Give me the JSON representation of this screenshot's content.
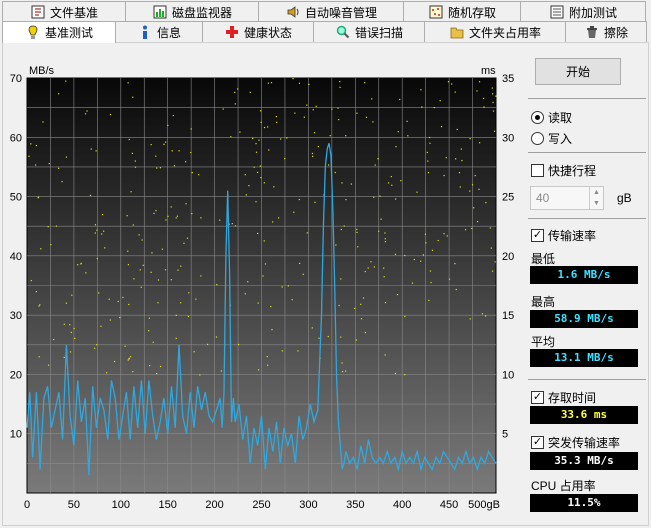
{
  "tabs_top": [
    {
      "label": "文件基准",
      "icon": "file-benchmark-icon"
    },
    {
      "label": "磁盘监视器",
      "icon": "disk-monitor-icon"
    },
    {
      "label": "自动噪音管理",
      "icon": "speaker-icon"
    },
    {
      "label": "随机存取",
      "icon": "random-access-icon"
    },
    {
      "label": "附加测试",
      "icon": "extra-tests-icon"
    }
  ],
  "tabs_bottom": [
    {
      "label": "基准测试",
      "icon": "benchmark-icon",
      "active": true
    },
    {
      "label": "信息",
      "icon": "info-icon"
    },
    {
      "label": "健康状态",
      "icon": "health-cross-icon"
    },
    {
      "label": "错误扫描",
      "icon": "error-scan-icon"
    },
    {
      "label": "文件夹占用率",
      "icon": "folder-usage-icon"
    },
    {
      "label": "擦除",
      "icon": "erase-icon"
    }
  ],
  "panel": {
    "start_label": "开始",
    "read_label": "读取",
    "write_label": "写入",
    "short_stroke_label": "快捷行程",
    "short_stroke_value": "40",
    "short_stroke_unit": "gB",
    "transfer_rate_label": "传输速率",
    "min_label": "最低",
    "min_value": "1.6 MB/s",
    "max_label": "最高",
    "max_value": "58.9 MB/s",
    "avg_label": "平均",
    "avg_value": "13.1 MB/s",
    "access_time_label": "存取时间",
    "access_time_value": "33.6 ms",
    "burst_rate_label": "突发传输速率",
    "burst_rate_value": "35.3 MB/s",
    "cpu_label": "CPU 占用率",
    "cpu_value": "11.5%"
  },
  "chart_data": {
    "type": "line",
    "y_left_label": "MB/s",
    "y_right_label": "ms",
    "x_max_label": "500gB",
    "ylim_left": [
      0,
      70
    ],
    "ylim_right": [
      0,
      35
    ],
    "xlim": [
      0,
      500
    ],
    "x_ticks": [
      "0",
      "50",
      "100",
      "150",
      "200",
      "250",
      "300",
      "350",
      "400",
      "450",
      "500gB"
    ],
    "y_left_ticks": [
      "70",
      "60",
      "50",
      "40",
      "30",
      "20",
      "10"
    ],
    "y_right_ticks": [
      "35",
      "30",
      "25",
      "20",
      "15",
      "10",
      "5"
    ],
    "grid": true,
    "series": [
      {
        "name": "传输速率",
        "color": "#2fa8e0",
        "x": [
          0,
          3,
          6,
          10,
          14,
          18,
          22,
          26,
          30,
          34,
          38,
          42,
          46,
          50,
          54,
          58,
          62,
          66,
          70,
          74,
          78,
          82,
          86,
          90,
          94,
          98,
          102,
          106,
          110,
          114,
          118,
          122,
          126,
          130,
          134,
          138,
          142,
          146,
          150,
          154,
          158,
          162,
          166,
          170,
          174,
          178,
          182,
          186,
          190,
          194,
          198,
          202,
          206,
          208,
          210,
          212,
          214,
          216,
          218,
          220,
          222,
          226,
          230,
          234,
          238,
          242,
          246,
          250,
          254,
          258,
          262,
          266,
          270,
          274,
          278,
          282,
          286,
          290,
          294,
          298,
          302,
          306,
          310,
          314,
          316,
          318,
          320,
          322,
          324,
          326,
          328,
          330,
          332,
          334,
          336,
          338,
          340,
          344,
          348,
          352,
          356,
          360,
          364,
          368,
          372,
          376,
          380,
          384,
          388,
          392,
          396,
          400,
          404,
          408,
          412,
          416,
          420,
          424,
          428,
          432,
          436,
          440,
          444,
          448,
          452,
          456,
          460,
          464,
          468,
          472,
          476,
          480,
          484,
          488,
          492,
          496,
          500
        ],
        "y": [
          11,
          17,
          6,
          17,
          4,
          16,
          18,
          11,
          14,
          17,
          9,
          25,
          13,
          8,
          19,
          12,
          16,
          3,
          18,
          11,
          16,
          14,
          9,
          19,
          16,
          9,
          13,
          17,
          9,
          18,
          11,
          19,
          10,
          19,
          13,
          9,
          12,
          16,
          10,
          18,
          11,
          25,
          13,
          10,
          17,
          11,
          18,
          14,
          17,
          13,
          12,
          14,
          16,
          11,
          17,
          40,
          51,
          37,
          12,
          16,
          12,
          15,
          9,
          13,
          5,
          11,
          8,
          13,
          4,
          11,
          7,
          12,
          5,
          11,
          8,
          10,
          5,
          13,
          9,
          11,
          15,
          12,
          14,
          30,
          45,
          55,
          58,
          59,
          57,
          48,
          35,
          20,
          12,
          8,
          4,
          5,
          7,
          5,
          6,
          4,
          8,
          5,
          9,
          6,
          5,
          6,
          5,
          7,
          5,
          6,
          4,
          7,
          5,
          6,
          5,
          7,
          4,
          6,
          5,
          4,
          6,
          5,
          7,
          6,
          5,
          4,
          6,
          5,
          7,
          5,
          6,
          4,
          6,
          5,
          7,
          6,
          5
        ]
      },
      {
        "name": "存取时间",
        "color": "#e0e020",
        "type": "scatter"
      }
    ]
  }
}
